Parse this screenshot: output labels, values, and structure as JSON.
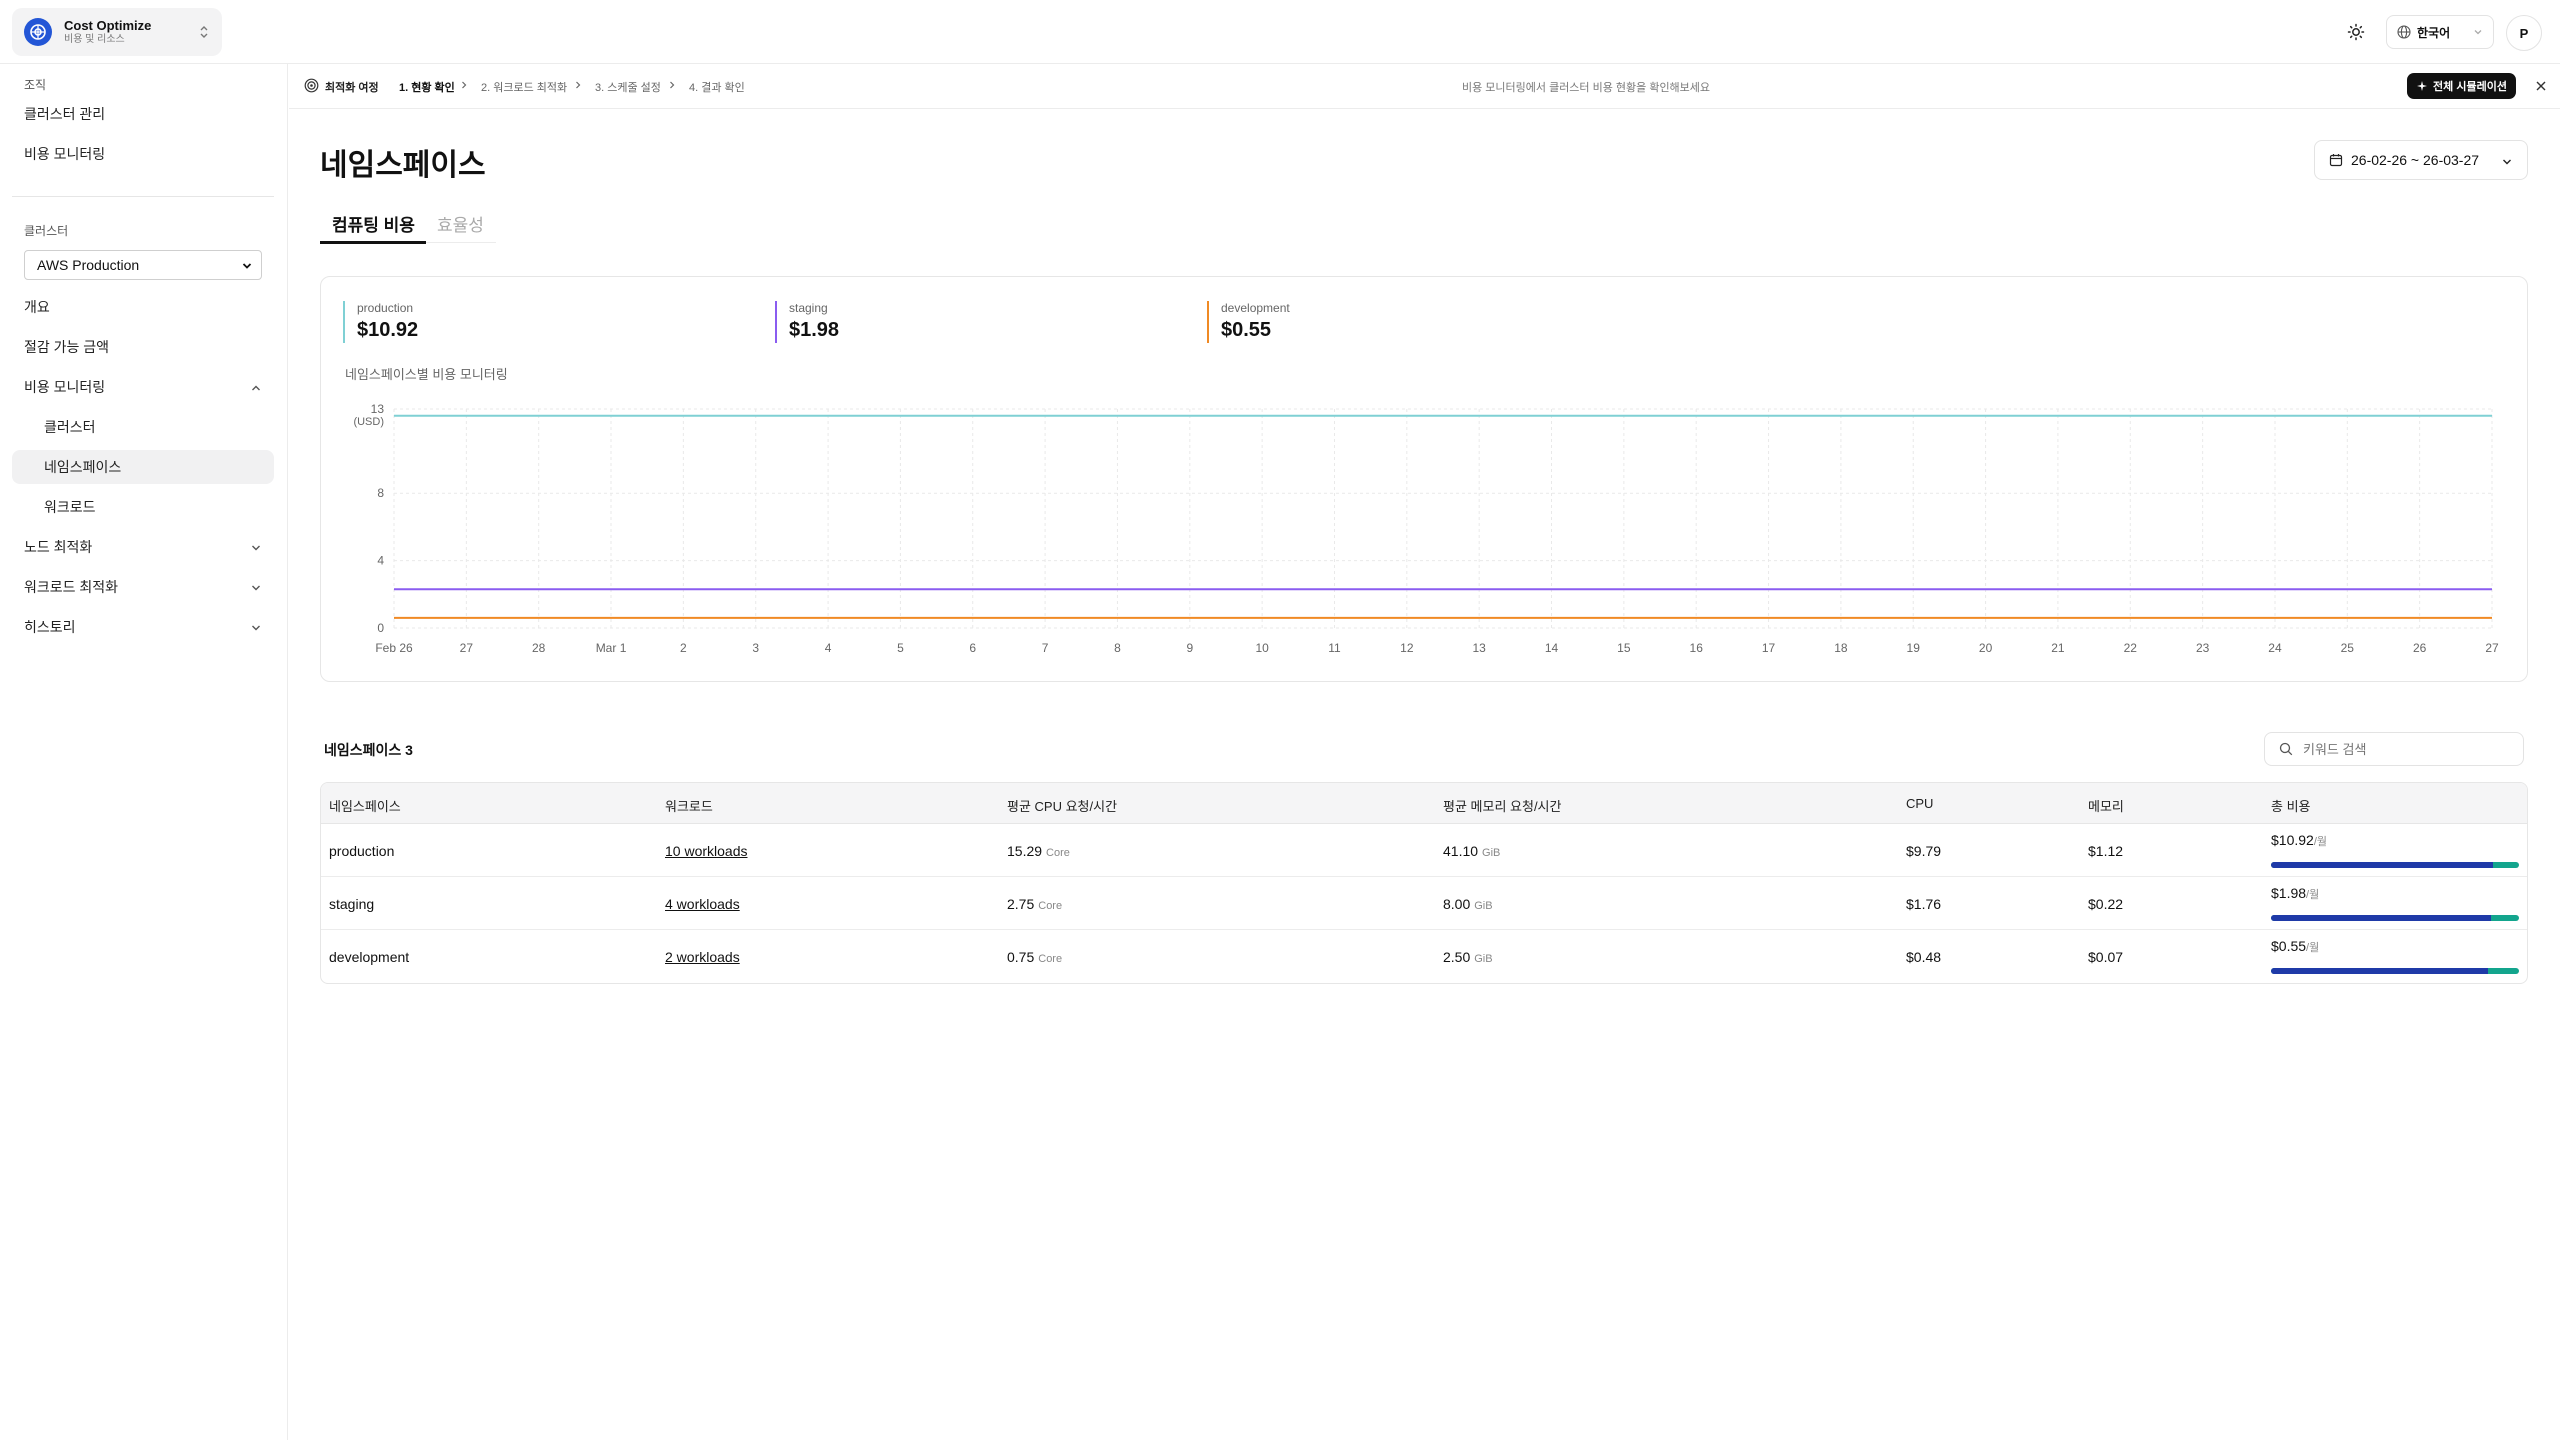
{
  "app": {
    "name": "Cost Optimize",
    "subtitle": "비용 및 리소스"
  },
  "topbar": {
    "language": "한국어",
    "avatar_initial": "P"
  },
  "sidebar": {
    "org_label": "조직",
    "org_links": [
      "클러스터 관리",
      "비용 모니터링"
    ],
    "cluster_label": "클러스터",
    "cluster_selected": "AWS Production",
    "nav": {
      "overview": "개요",
      "savings": "절감 가능 금액",
      "cost_monitoring": "비용 모니터링",
      "sub_cluster": "클러스터",
      "sub_namespace": "네임스페이스",
      "sub_workload": "워크로드",
      "node_opt": "노드 최적화",
      "workload_opt": "워크로드 최적화",
      "history": "히스토리"
    }
  },
  "journey": {
    "title": "최적화 여정",
    "steps": [
      "1. 현황 확인",
      "2. 워크로드 최적화",
      "3. 스케줄 설정",
      "4. 결과 확인"
    ],
    "hint": "비용 모니터링에서 클러스터 비용 현황을 확인해보세요",
    "simulate_button": "전체 시뮬레이션"
  },
  "page": {
    "title": "네임스페이스",
    "date_range": "26-02-26 ~ 26-03-27",
    "tabs": [
      "컴퓨팅 비용",
      "효율성"
    ]
  },
  "chart_data": {
    "type": "line",
    "title": "네임스페이스별 비용 모니터링",
    "ylabel": "(USD)",
    "ylim": [
      0,
      13
    ],
    "yticks": [
      0,
      4,
      8,
      13
    ],
    "x": [
      "Feb 26",
      "27",
      "28",
      "Mar 1",
      "2",
      "3",
      "4",
      "5",
      "6",
      "7",
      "8",
      "9",
      "10",
      "11",
      "12",
      "13",
      "14",
      "15",
      "16",
      "17",
      "18",
      "19",
      "20",
      "21",
      "22",
      "23",
      "24",
      "25",
      "26",
      "27"
    ],
    "series": [
      {
        "name": "production",
        "color": "#7fd0d4",
        "total": "$10.92",
        "values": [
          12.6,
          12.6,
          12.6,
          12.6,
          12.6,
          12.6,
          12.6,
          12.6,
          12.6,
          12.6,
          12.6,
          12.6,
          12.6,
          12.6,
          12.6,
          12.6,
          12.6,
          12.6,
          12.6,
          12.6,
          12.6,
          12.6,
          12.6,
          12.6,
          12.6,
          12.6,
          12.6,
          12.6,
          12.6,
          12.6
        ]
      },
      {
        "name": "staging",
        "color": "#8a5cf0",
        "total": "$1.98",
        "values": [
          2.3,
          2.3,
          2.3,
          2.3,
          2.3,
          2.3,
          2.3,
          2.3,
          2.3,
          2.3,
          2.3,
          2.3,
          2.3,
          2.3,
          2.3,
          2.3,
          2.3,
          2.3,
          2.3,
          2.3,
          2.3,
          2.3,
          2.3,
          2.3,
          2.3,
          2.3,
          2.3,
          2.3,
          2.3,
          2.3
        ]
      },
      {
        "name": "development",
        "color": "#f08a24",
        "total": "$0.55",
        "values": [
          0.6,
          0.6,
          0.6,
          0.6,
          0.6,
          0.6,
          0.6,
          0.6,
          0.6,
          0.6,
          0.6,
          0.6,
          0.6,
          0.6,
          0.6,
          0.6,
          0.6,
          0.6,
          0.6,
          0.6,
          0.6,
          0.6,
          0.6,
          0.6,
          0.6,
          0.6,
          0.6,
          0.6,
          0.6,
          0.6
        ]
      }
    ],
    "grid": true
  },
  "table": {
    "count_label": "네임스페이스 3",
    "search_placeholder": "키워드 검색",
    "headers": [
      "네임스페이스",
      "워크로드",
      "평균 CPU 요청/시간",
      "평균 메모리 요청/시간",
      "CPU",
      "메모리",
      "총 비용"
    ],
    "rows": [
      {
        "namespace": "production",
        "workloads": "10 workloads",
        "cpu_req": "15.29",
        "cpu_unit": "Core",
        "mem_req": "41.10",
        "mem_unit": "GiB",
        "cpu_cost": "$9.79",
        "mem_cost": "$1.12",
        "total": "$10.92",
        "per": "/월",
        "cpu_share": 0.896
      },
      {
        "namespace": "staging",
        "workloads": "4 workloads",
        "cpu_req": "2.75",
        "cpu_unit": "Core",
        "mem_req": "8.00",
        "mem_unit": "GiB",
        "cpu_cost": "$1.76",
        "mem_cost": "$0.22",
        "total": "$1.98",
        "per": "/월",
        "cpu_share": 0.889
      },
      {
        "namespace": "development",
        "workloads": "2 workloads",
        "cpu_req": "0.75",
        "cpu_unit": "Core",
        "mem_req": "2.50",
        "mem_unit": "GiB",
        "cpu_cost": "$0.48",
        "mem_cost": "$0.07",
        "total": "$0.55",
        "per": "/월",
        "cpu_share": 0.873
      }
    ]
  },
  "colors": {
    "brand": "#2356d6",
    "bar_cpu": "#1f3aa8",
    "bar_memory": "#13a58d"
  }
}
